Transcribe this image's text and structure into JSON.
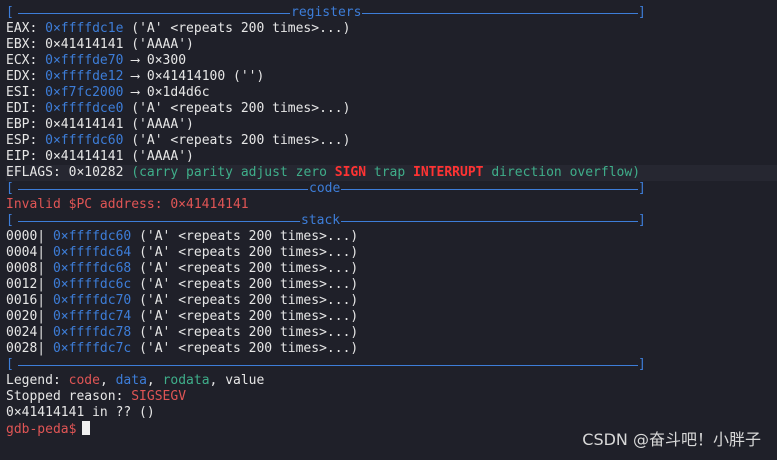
{
  "sections": {
    "registers": "registers",
    "code": "code",
    "stack": "stack"
  },
  "registers": [
    {
      "name": "EAX:",
      "addr": "0×ffffdc1e",
      "rest": " ('A' <repeats 200 times>...)"
    },
    {
      "name": "EBX:",
      "addr": "",
      "rest": "0×41414141 ('AAAA')"
    },
    {
      "name": "ECX:",
      "addr": "0×ffffde70",
      "rest": " ⟶ 0×300"
    },
    {
      "name": "EDX:",
      "addr": "0×ffffde12",
      "rest": " ⟶ 0×41414100 ('')"
    },
    {
      "name": "ESI:",
      "addr": "0×f7fc2000",
      "rest": " ⟶ 0×1d4d6c"
    },
    {
      "name": "EDI:",
      "addr": "0×ffffdce0",
      "rest": " ('A' <repeats 200 times>...)"
    },
    {
      "name": "EBP:",
      "addr": "",
      "rest": "0×41414141 ('AAAA')"
    },
    {
      "name": "ESP:",
      "addr": "0×ffffdc60",
      "rest": " ('A' <repeats 200 times>...)"
    },
    {
      "name": "EIP:",
      "addr": "",
      "rest": "0×41414141 ('AAAA')"
    }
  ],
  "eflags": {
    "label": "EFLAGS:",
    "value": "0×10282",
    "open": "(",
    "f1": "carry parity adjust zero",
    "sign": "SIGN",
    "f2": "trap",
    "interrupt": "INTERRUPT",
    "f3": "direction overflow",
    "close": ")"
  },
  "code": {
    "message": "Invalid $PC address: 0×41414141"
  },
  "stack": [
    {
      "offset": "0000|",
      "addr": "0×ffffdc60",
      "rest": " ('A' <repeats 200 times>...)"
    },
    {
      "offset": "0004|",
      "addr": "0×ffffdc64",
      "rest": " ('A' <repeats 200 times>...)"
    },
    {
      "offset": "0008|",
      "addr": "0×ffffdc68",
      "rest": " ('A' <repeats 200 times>...)"
    },
    {
      "offset": "0012|",
      "addr": "0×ffffdc6c",
      "rest": " ('A' <repeats 200 times>...)"
    },
    {
      "offset": "0016|",
      "addr": "0×ffffdc70",
      "rest": " ('A' <repeats 200 times>...)"
    },
    {
      "offset": "0020|",
      "addr": "0×ffffdc74",
      "rest": " ('A' <repeats 200 times>...)"
    },
    {
      "offset": "0024|",
      "addr": "0×ffffdc78",
      "rest": " ('A' <repeats 200 times>...)"
    },
    {
      "offset": "0028|",
      "addr": "0×ffffdc7c",
      "rest": " ('A' <repeats 200 times>...)"
    }
  ],
  "legend": {
    "label": "Legend: ",
    "code": "code",
    "sep1": ", ",
    "data": "data",
    "sep2": ", ",
    "rodata": "rodata",
    "sep3": ", ",
    "value": "value"
  },
  "stopped": {
    "label": "Stopped reason: ",
    "reason": "SIGSEGV"
  },
  "location": "0×41414141 in ?? ()",
  "prompt": "gdb-peda$",
  "watermark": "CSDN @奋斗吧！小胖子",
  "colors": {
    "background": "#1f2029",
    "address_blue": "#3d7dd8",
    "code_red": "#e05555",
    "rodata_green": "#3fae8a"
  }
}
